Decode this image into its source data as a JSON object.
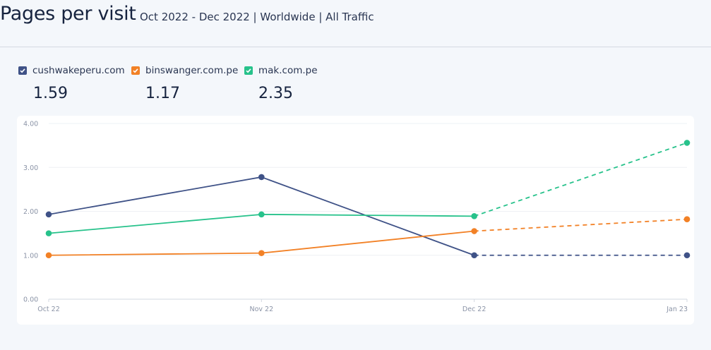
{
  "header": {
    "title": "Pages per visit",
    "subtitle": "Oct 2022 - Dec 2022 | Worldwide | All Traffic"
  },
  "legend": [
    {
      "label": "cushwakeperu.com",
      "value": "1.59",
      "color": "#3f5287",
      "checked": true
    },
    {
      "label": "binswanger.com.pe",
      "value": "1.17",
      "color": "#f28126",
      "checked": true
    },
    {
      "label": "mak.com.pe",
      "value": "2.35",
      "color": "#27c28b",
      "checked": true
    }
  ],
  "chart_data": {
    "type": "line",
    "x": [
      "Oct 22",
      "Nov 22",
      "Dec 22",
      "Jan 23"
    ],
    "y_ticks": [
      "0.00",
      "1.00",
      "2.00",
      "3.00",
      "4.00"
    ],
    "ylim": [
      0,
      4
    ],
    "grid": true,
    "dashed_from_index": 2,
    "series": [
      {
        "name": "cushwakeperu.com",
        "color": "#3f5287",
        "values": [
          1.93,
          2.78,
          1.0,
          1.0
        ]
      },
      {
        "name": "binswanger.com.pe",
        "color": "#f28126",
        "values": [
          1.0,
          1.05,
          1.55,
          1.82
        ]
      },
      {
        "name": "mak.com.pe",
        "color": "#27c28b",
        "values": [
          1.5,
          1.93,
          1.89,
          3.56
        ]
      }
    ]
  }
}
